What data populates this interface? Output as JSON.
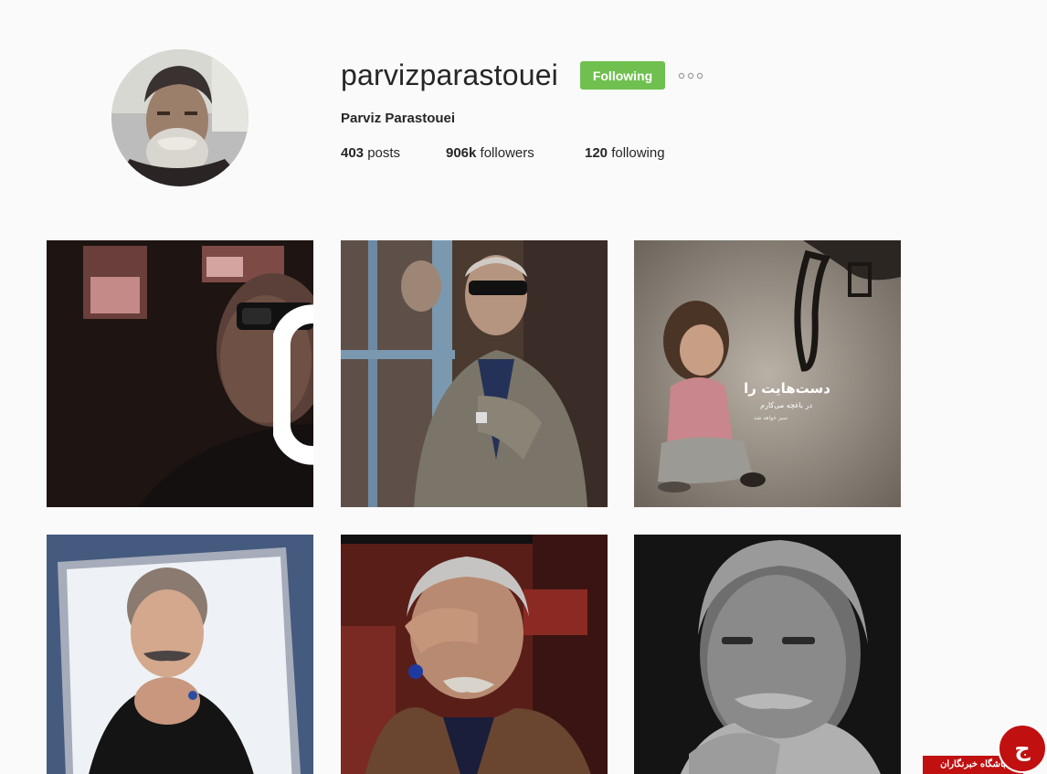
{
  "profile": {
    "username": "parvizparastouei",
    "full_name": "Parviz Parastouei",
    "follow_button_label": "Following",
    "stats": {
      "posts_count": "403",
      "posts_label": "posts",
      "followers_count": "906k",
      "followers_label": "followers",
      "following_count": "120",
      "following_label": "following"
    }
  },
  "posts": [
    {
      "kind": "video",
      "icon": "video-camera-icon"
    },
    {
      "kind": "photo"
    },
    {
      "kind": "photo",
      "overlay_text": {
        "title": "دست‌هایت را",
        "line1": "در باغچه می‌کارم",
        "line2": "سبز خواهد شد"
      }
    },
    {
      "kind": "photo"
    },
    {
      "kind": "photo"
    },
    {
      "kind": "photo"
    }
  ],
  "watermark": {
    "text": "باشگاه خبرنگاران",
    "glyph": "ج"
  },
  "colors": {
    "background": "#fafafa",
    "follow_button": "#70c050",
    "text": "#262626",
    "watermark": "#c01010"
  }
}
